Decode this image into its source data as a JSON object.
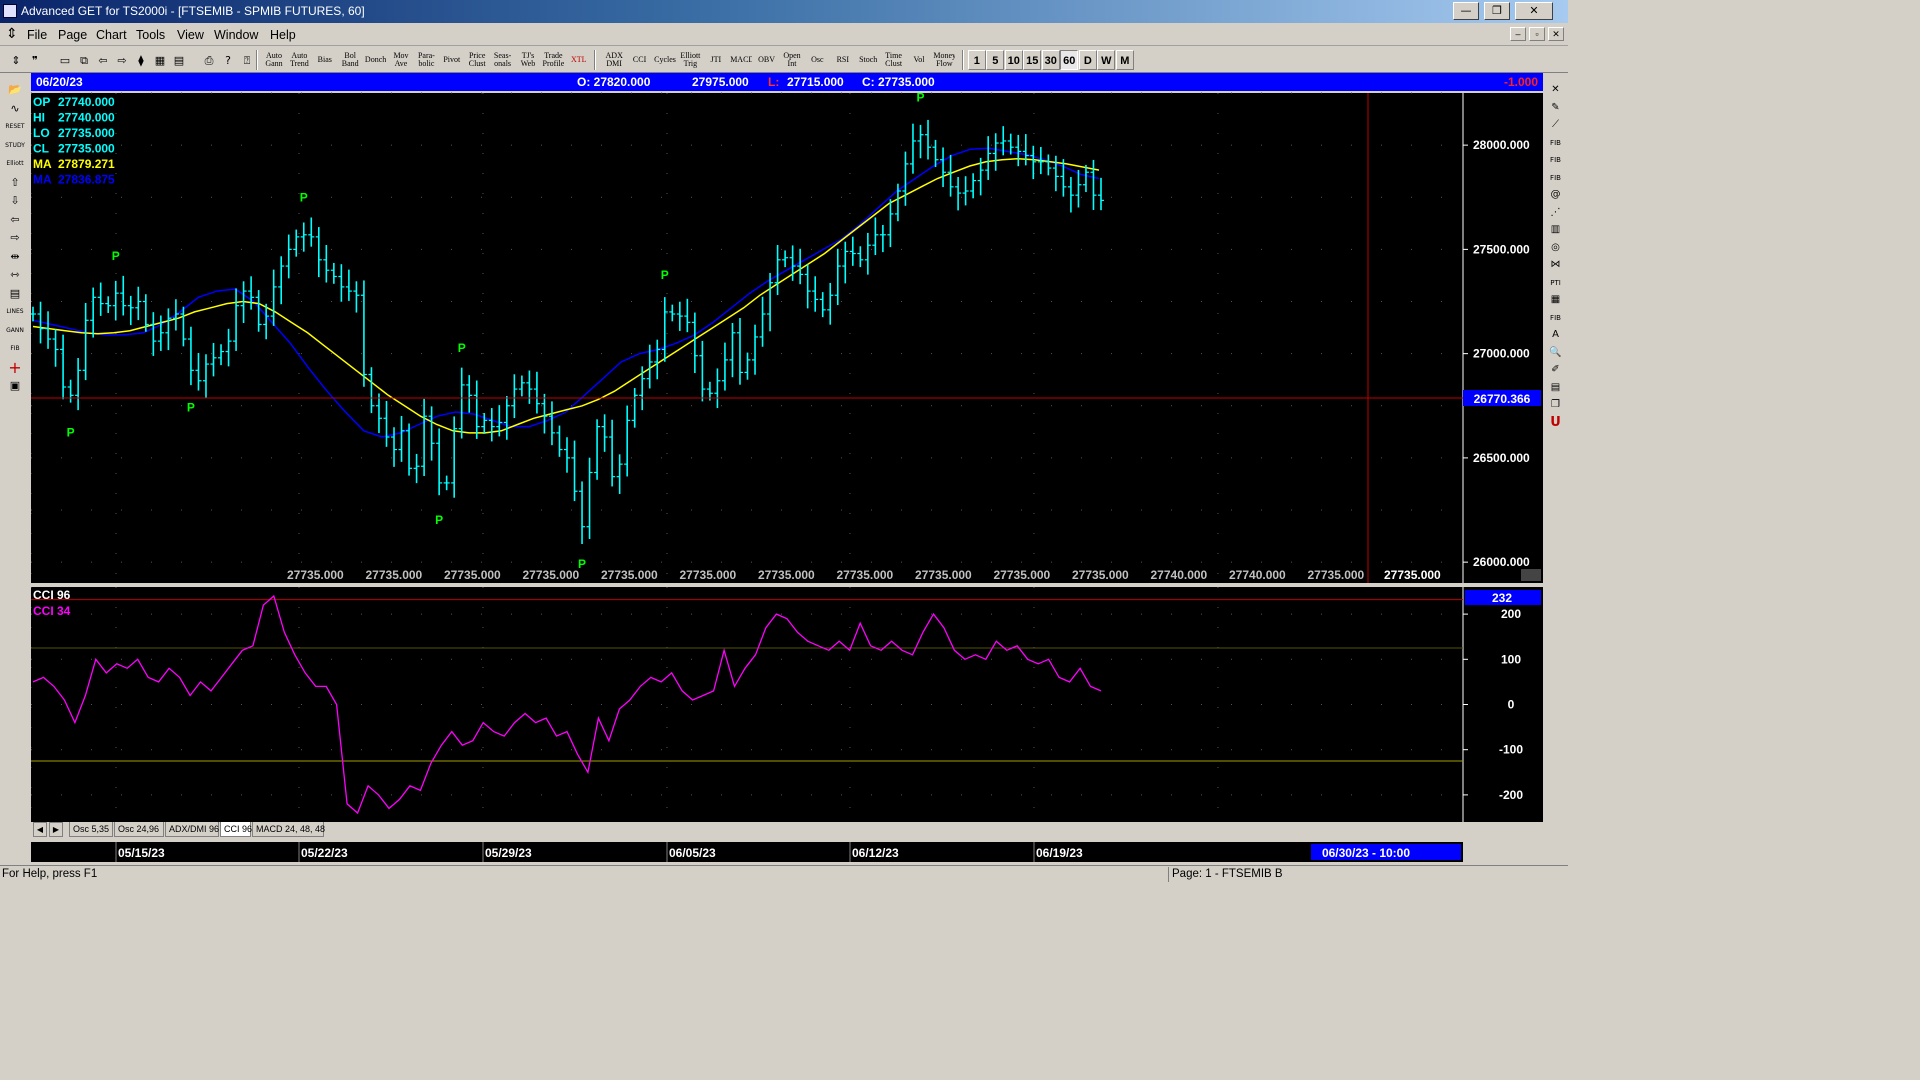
{
  "window": {
    "title": "Advanced GET for TS2000i - [FTSEMIB - SPMIB FUTURES, 60]",
    "buttons": [
      "—",
      "❐",
      "✕"
    ],
    "mdi_buttons": [
      "–",
      "▫",
      "✕"
    ]
  },
  "menu": [
    "File",
    "Page",
    "Chart",
    "Tools",
    "View",
    "Window",
    "Help"
  ],
  "toolbar": {
    "icons": [
      "pointer-icon",
      "quote-icon",
      "new-page-icon",
      "open-icon",
      "back-icon",
      "forward-icon",
      "link-icon",
      "grid-icon",
      "layout-icon",
      "print-icon",
      "help-icon",
      "context-help-icon"
    ],
    "icon_glyphs": [
      "⇕",
      "❞",
      "▭",
      "⧉",
      "⇦",
      "⇨",
      "⧫",
      "▦",
      "▤",
      "⎙",
      "?",
      "⍰"
    ],
    "study_buttons": [
      [
        "Auto",
        "Gann"
      ],
      [
        "Auto",
        "Trend"
      ],
      [
        "Bias"
      ],
      [
        "Bol",
        "Band"
      ],
      [
        "Donch"
      ],
      [
        "Mov",
        "Ave"
      ],
      [
        "Para-",
        "bolic"
      ],
      [
        "Pivot"
      ],
      [
        "Price",
        "Clust"
      ],
      [
        "Seas-",
        "onals"
      ],
      [
        "TJ's",
        "Web"
      ],
      [
        "Trade",
        "Profile"
      ],
      [
        "XTL"
      ],
      [
        "ADX",
        "DMI"
      ],
      [
        "CCI"
      ],
      [
        "Cycles"
      ],
      [
        "Elliott",
        "Trig"
      ],
      [
        "JTI"
      ],
      [
        "MACD"
      ],
      [
        "OBV"
      ],
      [
        "Open",
        "Int"
      ],
      [
        "Osc"
      ],
      [
        "RSI"
      ],
      [
        "Stoch"
      ],
      [
        "Time",
        "Clust"
      ],
      [
        "Vol"
      ],
      [
        "Money",
        "Flow"
      ]
    ],
    "periods": [
      "1",
      "5",
      "10",
      "15",
      "30",
      "60",
      "D",
      "W",
      "M"
    ],
    "active_period": "60"
  },
  "left_tools": [
    {
      "name": "open-icon",
      "glyph": "📂"
    },
    {
      "name": "cycles-icon",
      "glyph": "∿"
    },
    {
      "name": "reset-icon",
      "glyph": "RESET"
    },
    {
      "name": "study-icon",
      "glyph": "STUDY"
    },
    {
      "name": "elliott-icon",
      "glyph": "Elliott"
    },
    {
      "name": "arrow-up-icon",
      "glyph": "⇧"
    },
    {
      "name": "arrow-down-icon",
      "glyph": "⇩"
    },
    {
      "name": "arrow-left-icon",
      "glyph": "⇦"
    },
    {
      "name": "arrow-right-icon",
      "glyph": "⇨"
    },
    {
      "name": "compress-icon",
      "glyph": "⇹"
    },
    {
      "name": "expand-icon",
      "glyph": "⇿"
    },
    {
      "name": "table-icon",
      "glyph": "▤"
    },
    {
      "name": "lines-icon",
      "glyph": "LINES"
    },
    {
      "name": "gann-icon",
      "glyph": "GANN"
    },
    {
      "name": "fib-icon",
      "glyph": "FIB"
    },
    {
      "name": "crosshair-icon",
      "glyph": "+"
    },
    {
      "name": "save-icon",
      "glyph": "▣"
    }
  ],
  "right_tools": [
    {
      "name": "close-icon",
      "glyph": "✕"
    },
    {
      "name": "pencil-icon",
      "glyph": "✎"
    },
    {
      "name": "trendline-icon",
      "glyph": "⟋"
    },
    {
      "name": "fib-ret-icon",
      "glyph": "FIB"
    },
    {
      "name": "fib-ext-icon",
      "glyph": "FIB"
    },
    {
      "name": "fib-time-icon",
      "glyph": "FIB"
    },
    {
      "name": "spiral-icon",
      "glyph": "@"
    },
    {
      "name": "fan-icon",
      "glyph": "⋰"
    },
    {
      "name": "channel-icon",
      "glyph": "▥"
    },
    {
      "name": "ellipse-icon",
      "glyph": "◎"
    },
    {
      "name": "gann-box-icon",
      "glyph": "⋈"
    },
    {
      "name": "pti-icon",
      "glyph": "PTI"
    },
    {
      "name": "grid-icon",
      "glyph": "▦"
    },
    {
      "name": "fib-box-icon",
      "glyph": "FIB"
    },
    {
      "name": "text-icon",
      "glyph": "A"
    },
    {
      "name": "zoom-icon",
      "glyph": "🔍"
    },
    {
      "name": "marker-icon",
      "glyph": "✐"
    },
    {
      "name": "clipboard-icon",
      "glyph": "▤"
    },
    {
      "name": "copy-icon",
      "glyph": "❐"
    },
    {
      "name": "u-icon",
      "glyph": "U"
    }
  ],
  "header": {
    "date": "06/20/23",
    "open_label": "O: 27820.000",
    "high_value": "27975.000",
    "low_label": "L:",
    "low_value": "27715.000",
    "close_label": "C: 27735.000",
    "change": "-1.000"
  },
  "info_panel": [
    {
      "label": "OP",
      "value": "27740.000",
      "color": "#00ffff"
    },
    {
      "label": "HI",
      "value": "27740.000",
      "color": "#00ffff"
    },
    {
      "label": "LO",
      "value": "27735.000",
      "color": "#00ffff"
    },
    {
      "label": "CL",
      "value": "27735.000",
      "color": "#00ffff"
    },
    {
      "label": "MA",
      "value": "27879.271",
      "color": "#ffff00"
    },
    {
      "label": "MA",
      "value": "27836.875",
      "color": "#0000ff"
    }
  ],
  "price_labels": [
    "28000.000",
    "27500.000",
    "27000.000",
    "26500.000",
    "26000.000"
  ],
  "crosshair_price": "26770.366",
  "bottom_values": [
    "27735.000",
    "27735.000",
    "27735.000",
    "27735.000",
    "27735.000",
    "27735.000",
    "27735.000",
    "27735.000",
    "27735.000",
    "27735.000",
    "27735.000",
    "27740.000",
    "27740.000",
    "27735.000"
  ],
  "bottom_last_value": "27735.000",
  "pivot_label": "P",
  "cci_panel": {
    "label1": "CCI 96",
    "label2": "CCI  34",
    "current": "232",
    "axis_labels": [
      "200",
      "100",
      "0",
      "-100",
      "-200"
    ]
  },
  "tabs": [
    "Osc 5,35",
    "Osc 24,96",
    "ADX/DMI 96",
    "CCI 96",
    "MACD 24, 48, 48"
  ],
  "active_tab": "CCI 96",
  "date_axis": [
    "05/15/23",
    "05/22/23",
    "05/29/23",
    "06/05/23",
    "06/12/23",
    "06/19/23"
  ],
  "date_cursor": "06/30/23 - 10:00",
  "status": {
    "help": "For Help, press F1",
    "page": "Page: 1 - FTSEMIB B"
  },
  "colors": {
    "bars": "#00ffff",
    "ma_fast": "#ffff00",
    "ma_slow": "#0000ff",
    "pivot": "#00ff00",
    "cci": "#ff00ff",
    "header_bg": "#0000ff",
    "crosshair": "#c00000",
    "background": "#000000"
  },
  "chart_data": {
    "type": "line",
    "price_axis": {
      "ylim": [
        25900,
        28250
      ],
      "ticks": [
        28000,
        27500,
        27000,
        26500,
        26000
      ]
    },
    "price_close": [
      27190,
      27120,
      27070,
      27020,
      26840,
      26800,
      26920,
      27160,
      27270,
      27240,
      27230,
      27290,
      27230,
      27220,
      27250,
      27140,
      27060,
      27100,
      27170,
      27190,
      27070,
      26920,
      26870,
      26950,
      26980,
      27010,
      27060,
      27230,
      27300,
      27270,
      27140,
      27180,
      27320,
      27420,
      27500,
      27560,
      27570,
      27560,
      27450,
      27400,
      27370,
      27320,
      27300,
      27280,
      26900,
      26750,
      26690,
      26600,
      26540,
      26630,
      26450,
      26460,
      26700,
      26570,
      26380,
      26380,
      26640,
      26850,
      26800,
      26650,
      26680,
      26650,
      26670,
      26750,
      26830,
      26860,
      26830,
      26760,
      26700,
      26620,
      26540,
      26500,
      26340,
      26170,
      26430,
      26650,
      26600,
      26410,
      26470,
      26680,
      26800,
      26880,
      26960,
      27020,
      27200,
      27190,
      27180,
      27150,
      26990,
      26830,
      26810,
      26870,
      26970,
      27100,
      26910,
      26970,
      27080,
      27190,
      27340,
      27450,
      27460,
      27420,
      27380,
      27300,
      27260,
      27210,
      27280,
      27420,
      27490,
      27480,
      27450,
      27520,
      27570,
      27570,
      27670,
      27780,
      27910,
      28020,
      28050,
      27990,
      27930,
      27870,
      27800,
      27770,
      27780,
      27830,
      27880,
      27960,
      28010,
      28020,
      27990,
      27970,
      27950,
      27920,
      27920,
      27890,
      27850,
      27800,
      27760,
      27810,
      27870,
      27760,
      27735
    ],
    "ma_fast": [
      27130,
      27120,
      27110,
      27100,
      27095,
      27100,
      27110,
      27130,
      27150,
      27170,
      27200,
      27220,
      27240,
      27250,
      27240,
      27200,
      27150,
      27100,
      27040,
      26980,
      26920,
      26860,
      26800,
      26750,
      26700,
      26660,
      26630,
      26620,
      26620,
      26630,
      26660,
      26690,
      26710,
      26730,
      26750,
      26780,
      26820,
      26870,
      26920,
      26970,
      27020,
      27070,
      27120,
      27170,
      27220,
      27280,
      27330,
      27380,
      27430,
      27480,
      27540,
      27600,
      27660,
      27720,
      27760,
      27800,
      27840,
      27870,
      27900,
      27920,
      27930,
      27935,
      27930,
      27920,
      27910,
      27895,
      27880
    ],
    "ma_slow": [
      27160,
      27140,
      27120,
      27100,
      27090,
      27090,
      27100,
      27140,
      27200,
      27270,
      27300,
      27310,
      27250,
      27150,
      27050,
      26930,
      26820,
      26720,
      26630,
      26600,
      26620,
      26660,
      26700,
      26720,
      26710,
      26680,
      26650,
      26650,
      26680,
      26720,
      26800,
      26880,
      26960,
      27000,
      27020,
      27050,
      27090,
      27150,
      27220,
      27290,
      27350,
      27400,
      27450,
      27500,
      27550,
      27620,
      27700,
      27780,
      27840,
      27900,
      27950,
      27980,
      27985,
      27970,
      27955,
      27930,
      27900,
      27860,
      27840
    ],
    "cci_axis": {
      "ylim": [
        -260,
        260
      ],
      "ticks": [
        200,
        100,
        0,
        -100,
        -200
      ]
    },
    "cci_34": [
      50,
      60,
      40,
      10,
      -40,
      20,
      100,
      70,
      90,
      80,
      100,
      60,
      50,
      80,
      60,
      20,
      50,
      30,
      60,
      90,
      120,
      130,
      220,
      240,
      160,
      110,
      70,
      40,
      40,
      0,
      -220,
      -240,
      -180,
      -200,
      -230,
      -210,
      -180,
      -190,
      -130,
      -90,
      -60,
      -90,
      -80,
      -40,
      -60,
      -70,
      -40,
      -20,
      -40,
      -30,
      -70,
      -60,
      -110,
      -150,
      -30,
      -80,
      -10,
      10,
      40,
      60,
      50,
      70,
      30,
      10,
      20,
      30,
      120,
      40,
      80,
      110,
      170,
      200,
      190,
      160,
      140,
      130,
      120,
      140,
      120,
      180,
      130,
      120,
      140,
      120,
      110,
      160,
      200,
      170,
      120,
      100,
      110,
      100,
      140,
      120,
      130,
      100,
      90,
      100,
      60,
      50,
      80,
      40,
      30
    ]
  }
}
